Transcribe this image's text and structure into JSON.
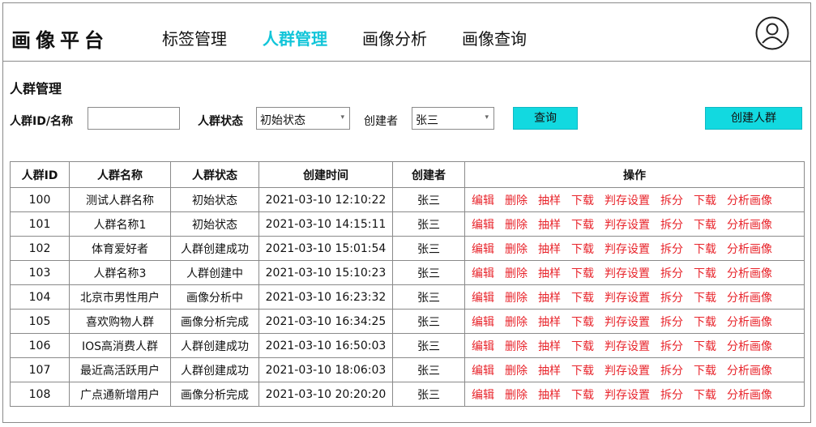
{
  "header": {
    "logo": "画像平台",
    "nav": [
      {
        "label": "标签管理",
        "active": false
      },
      {
        "label": "人群管理",
        "active": true
      },
      {
        "label": "画像分析",
        "active": false
      },
      {
        "label": "画像查询",
        "active": false
      }
    ],
    "avatar_icon": "user-avatar-icon"
  },
  "page": {
    "title": "人群管理"
  },
  "filters": {
    "id_name_label": "人群ID/名称",
    "id_name_value": "",
    "status_label": "人群状态",
    "status_value": "初始状态",
    "creator_label": "创建者",
    "creator_value": "张三",
    "search_label": "查询",
    "create_label": "创建人群"
  },
  "table": {
    "columns": [
      "人群ID",
      "人群名称",
      "人群状态",
      "创建时间",
      "创建者",
      "操作"
    ],
    "actions": [
      "编辑",
      "删除",
      "抽样",
      "下载",
      "判存设置",
      "拆分",
      "下载",
      "分析画像"
    ],
    "rows": [
      {
        "id": "100",
        "name": "测试人群名称",
        "status": "初始状态",
        "created": "2021-03-10 12:10:22",
        "creator": "张三"
      },
      {
        "id": "101",
        "name": "人群名称1",
        "status": "初始状态",
        "created": "2021-03-10 14:15:11",
        "creator": "张三"
      },
      {
        "id": "102",
        "name": "体育爱好者",
        "status": "人群创建成功",
        "created": "2021-03-10 15:01:54",
        "creator": "张三"
      },
      {
        "id": "103",
        "name": "人群名称3",
        "status": "人群创建中",
        "created": "2021-03-10 15:10:23",
        "creator": "张三"
      },
      {
        "id": "104",
        "name": "北京市男性用户",
        "status": "画像分析中",
        "created": "2021-03-10 16:23:32",
        "creator": "张三"
      },
      {
        "id": "105",
        "name": "喜欢购物人群",
        "status": "画像分析完成",
        "created": "2021-03-10 16:34:25",
        "creator": "张三"
      },
      {
        "id": "106",
        "name": "IOS高消费人群",
        "status": "人群创建成功",
        "created": "2021-03-10 16:50:03",
        "creator": "张三"
      },
      {
        "id": "107",
        "name": "最近高活跃用户",
        "status": "人群创建成功",
        "created": "2021-03-10 18:06:03",
        "creator": "张三"
      },
      {
        "id": "108",
        "name": "广点通新增用户",
        "status": "画像分析完成",
        "created": "2021-03-10 20:20:20",
        "creator": "张三"
      }
    ]
  },
  "colors": {
    "accent": "#12c5d9",
    "button": "#12d9e0",
    "action_link": "#e8242b",
    "border": "#8a8a8a"
  }
}
